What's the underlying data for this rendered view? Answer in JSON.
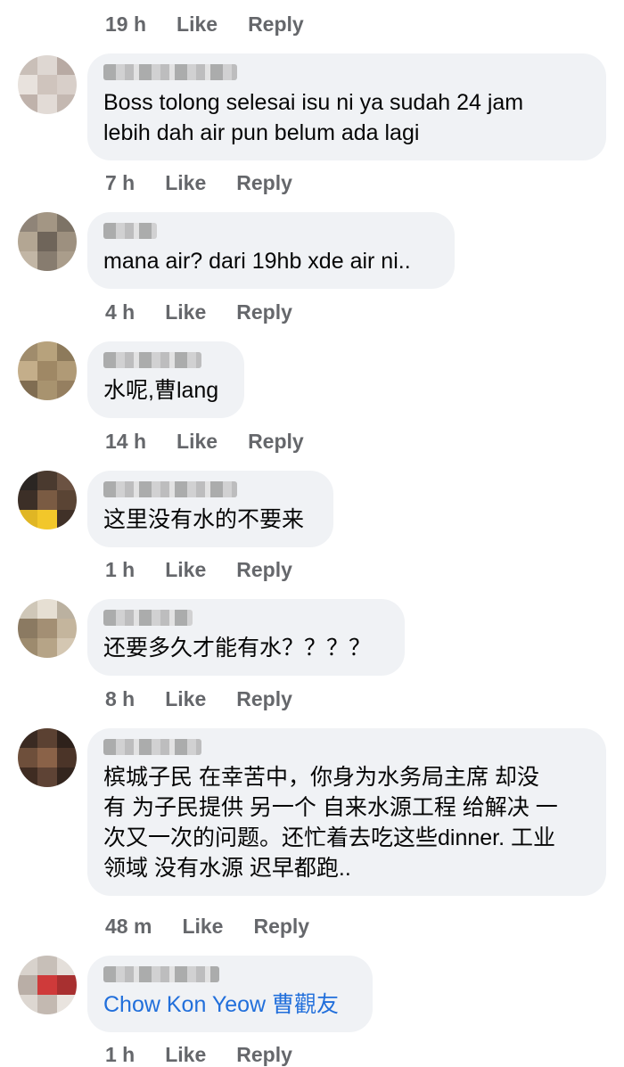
{
  "top_meta": {
    "time": "19 h",
    "like": "Like",
    "reply": "Reply"
  },
  "comments": [
    {
      "text": "Boss tolong selesai isu ni ya sudah 24 jam\nlebih dah air pun belum ada lagi",
      "time": "7 h",
      "like": "Like",
      "reply": "Reply",
      "avatar_colors": [
        "#c9bfb8",
        "#ded7d2",
        "#b8aaa3",
        "#e8e2dd",
        "#cfc4bd",
        "#d8cfc9",
        "#bfb2ab",
        "#e2dbd6",
        "#c4b8b1"
      ]
    },
    {
      "text": "mana air? dari 19hb xde air ni..",
      "time": "4 h",
      "like": "Like",
      "reply": "Reply",
      "avatar_colors": [
        "#8f8478",
        "#a39684",
        "#7d7366",
        "#b3a693",
        "#6f655a",
        "#9d907f",
        "#c2b6a5",
        "#877c6f",
        "#aa9d8b"
      ]
    },
    {
      "text": "水呢,曹lang",
      "time": "14 h",
      "like": "Like",
      "reply": "Reply",
      "avatar_colors": [
        "#a08c6c",
        "#b7a27c",
        "#8d7a5b",
        "#c4ae8a",
        "#9f8865",
        "#b09a76",
        "#806d52",
        "#a8936f",
        "#957f60"
      ]
    },
    {
      "text": "这里没有水的不要来",
      "time": "1 h",
      "like": "Like",
      "reply": "Reply",
      "avatar_colors": [
        "#2b2623",
        "#4a3a2f",
        "#6b5242",
        "#3c2f27",
        "#7a5b43",
        "#5a4434",
        "#e0b624",
        "#f2c72a",
        "#403128"
      ]
    },
    {
      "text": "还要多久才能有水？？？？",
      "time": "8 h",
      "like": "Like",
      "reply": "Reply",
      "avatar_colors": [
        "#cfc7b8",
        "#e6dfd3",
        "#bbb1a0",
        "#8b7a62",
        "#a38f74",
        "#c4b59d",
        "#9d8b6e",
        "#b6a487",
        "#d4c7b2"
      ]
    },
    {
      "text": "槟城子民 在幸苦中，你身为水务局主席 却没\n有 为子民提供 另一个 自来水源工程 给解决 一\n次又一次的问题。还忙着去吃这些dinner. 工业\n领域 没有水源 迟早都跑..",
      "time": "48 m",
      "like": "Like",
      "reply": "Reply",
      "avatar_colors": [
        "#3a2a22",
        "#5b4132",
        "#2e211b",
        "#6e4f3b",
        "#8a6248",
        "#4b3428",
        "#3f2c22",
        "#5e4335",
        "#33251e"
      ]
    },
    {
      "text": "Chow Kon Yeow 曹觀友",
      "time": "1 h",
      "like": "Like",
      "reply": "Reply",
      "avatar_colors": [
        "#d8d2cc",
        "#c7bfb8",
        "#e4dfda",
        "#b9aea6",
        "#cf3a3a",
        "#a83030",
        "#ddd7d1",
        "#c3b9b1",
        "#e9e4df"
      ]
    }
  ]
}
